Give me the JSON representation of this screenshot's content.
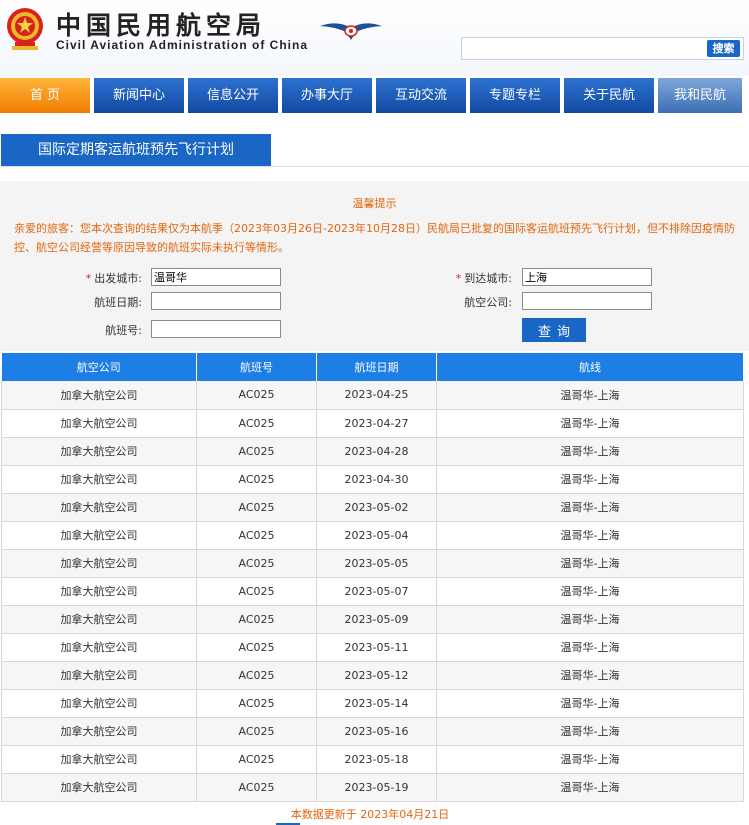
{
  "header": {
    "title_cn": "中国民用航空局",
    "title_en": "Civil Aviation Administration of China",
    "search": {
      "placeholder": "",
      "button_label": "搜索"
    }
  },
  "nav": {
    "items": [
      {
        "label": "首 页",
        "active": true
      },
      {
        "label": "新闻中心"
      },
      {
        "label": "信息公开"
      },
      {
        "label": "办事大厅"
      },
      {
        "label": "互动交流"
      },
      {
        "label": "专题专栏"
      },
      {
        "label": "关于民航"
      },
      {
        "label": "我和民航"
      }
    ]
  },
  "section": {
    "title": "国际定期客运航班预先飞行计划"
  },
  "notice": {
    "title": "温馨提示",
    "text": "亲爱的旅客：您本次查询的结果仅为本航季（2023年03月26日-2023年10月28日）民航局已批复的国际客运航班预先飞行计划，但不排除因疫情防控、航空公司经营等原因导致的航班实际未执行等情形。"
  },
  "form": {
    "departure_label": "出发城市:",
    "departure_value": "温哥华",
    "arrival_label": "到达城市:",
    "arrival_value": "上海",
    "date_label": "航班日期:",
    "date_value": "",
    "airline_label": "航空公司:",
    "airline_value": "",
    "flight_label": "航班号:",
    "flight_value": "",
    "query_label": "查询"
  },
  "table": {
    "headers": [
      "航空公司",
      "航班号",
      "航班日期",
      "航线"
    ],
    "rows": [
      [
        "加拿大航空公司",
        "AC025",
        "2023-04-25",
        "温哥华-上海"
      ],
      [
        "加拿大航空公司",
        "AC025",
        "2023-04-27",
        "温哥华-上海"
      ],
      [
        "加拿大航空公司",
        "AC025",
        "2023-04-28",
        "温哥华-上海"
      ],
      [
        "加拿大航空公司",
        "AC025",
        "2023-04-30",
        "温哥华-上海"
      ],
      [
        "加拿大航空公司",
        "AC025",
        "2023-05-02",
        "温哥华-上海"
      ],
      [
        "加拿大航空公司",
        "AC025",
        "2023-05-04",
        "温哥华-上海"
      ],
      [
        "加拿大航空公司",
        "AC025",
        "2023-05-05",
        "温哥华-上海"
      ],
      [
        "加拿大航空公司",
        "AC025",
        "2023-05-07",
        "温哥华-上海"
      ],
      [
        "加拿大航空公司",
        "AC025",
        "2023-05-09",
        "温哥华-上海"
      ],
      [
        "加拿大航空公司",
        "AC025",
        "2023-05-11",
        "温哥华-上海"
      ],
      [
        "加拿大航空公司",
        "AC025",
        "2023-05-12",
        "温哥华-上海"
      ],
      [
        "加拿大航空公司",
        "AC025",
        "2023-05-14",
        "温哥华-上海"
      ],
      [
        "加拿大航空公司",
        "AC025",
        "2023-05-16",
        "温哥华-上海"
      ],
      [
        "加拿大航空公司",
        "AC025",
        "2023-05-18",
        "温哥华-上海"
      ],
      [
        "加拿大航空公司",
        "AC025",
        "2023-05-19",
        "温哥华-上海"
      ]
    ]
  },
  "footer": {
    "update_note": "本数据更新于 2023年04月21日"
  },
  "colors": {
    "primary": "#1a66c4",
    "accent": "#f07c00",
    "notice": "#e2660e",
    "table_header": "#1d7ee6"
  }
}
